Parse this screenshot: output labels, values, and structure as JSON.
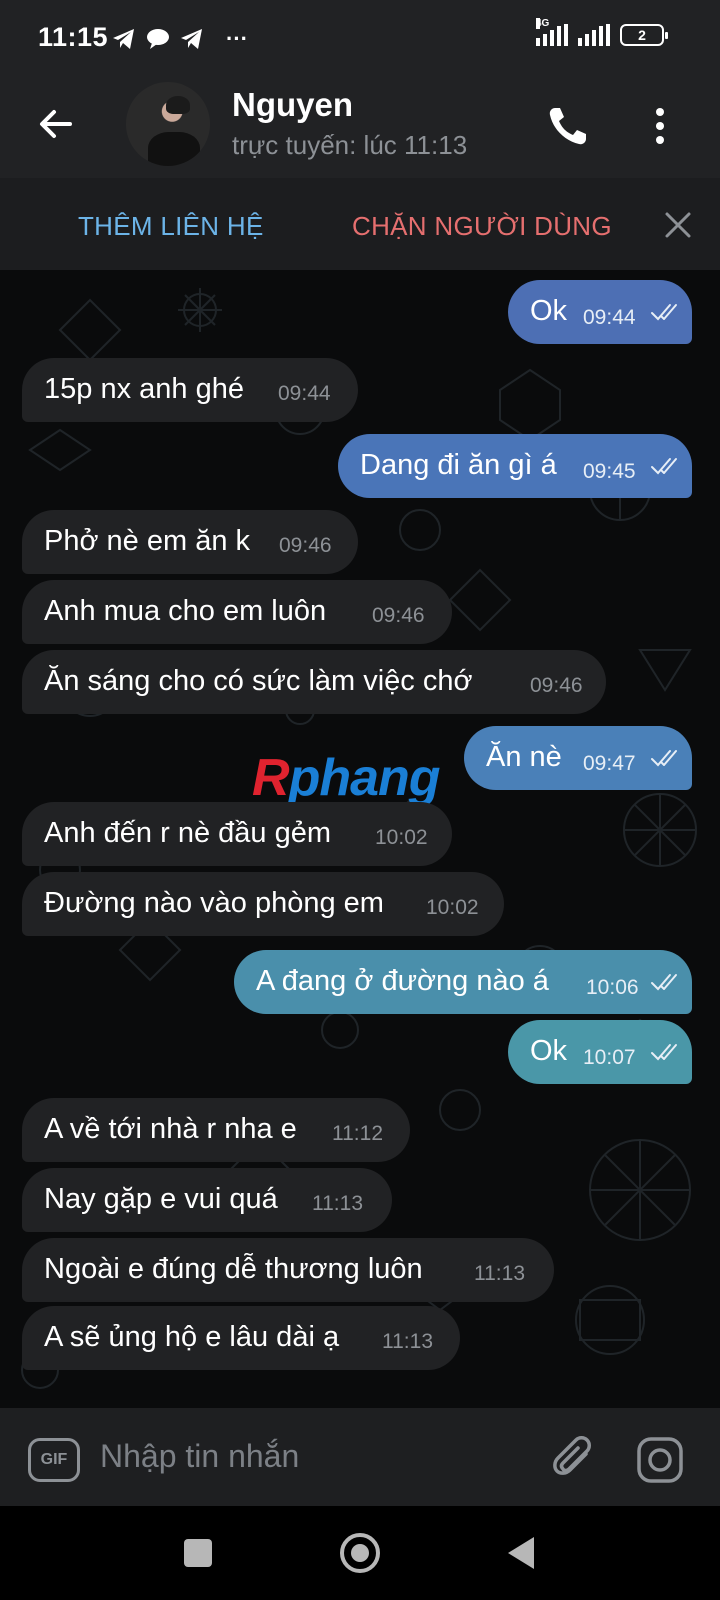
{
  "status_bar": {
    "time": "11:15",
    "network": "4G",
    "battery": "2",
    "more": "···"
  },
  "header": {
    "contact_name": "Nguyen",
    "presence": "trực tuyến: lúc 11:13"
  },
  "action_bar": {
    "add_contact": "THÊM LIÊN HỆ",
    "block_user": "CHẶN NGƯỜI DÙNG"
  },
  "colors": {
    "incoming_bubble": "#212224",
    "outgoing_blue": "#4a70b5",
    "outgoing_teal": "#4a94a6",
    "add_contact": "#6cb4e8",
    "block_user": "#e56f6f"
  },
  "messages": [
    {
      "side": "out",
      "text": "Ok",
      "time": "09:44"
    },
    {
      "side": "in",
      "text": "15p nx anh ghé",
      "time": "09:44"
    },
    {
      "side": "out",
      "text": "Dang đi ăn gì á",
      "time": "09:45"
    },
    {
      "side": "in",
      "text": "Phở nè em ăn k",
      "time": "09:46"
    },
    {
      "side": "in",
      "text": "Anh mua cho em luôn",
      "time": "09:46"
    },
    {
      "side": "in",
      "text": "Ăn sáng cho có sức làm việc chớ",
      "time": "09:46"
    },
    {
      "side": "out",
      "text": "Ăn nè",
      "time": "09:47"
    },
    {
      "side": "in",
      "text": "Anh đến r nè đầu gẻm",
      "time": "10:02"
    },
    {
      "side": "in",
      "text": "Đường nào vào phòng em",
      "time": "10:02"
    },
    {
      "side": "out",
      "text": "A đang ở đường nào á",
      "time": "10:06"
    },
    {
      "side": "out",
      "text": "Ok",
      "time": "10:07"
    },
    {
      "side": "in",
      "text": "A về tới nhà r nha e",
      "time": "11:12"
    },
    {
      "side": "in",
      "text": "Nay gặp e vui quá",
      "time": "11:13"
    },
    {
      "side": "in",
      "text": "Ngoài e đúng dễ thương luôn",
      "time": "11:13"
    },
    {
      "side": "in",
      "text": "A sẽ ủng hộ e lâu dài ạ",
      "time": "11:13"
    }
  ],
  "watermark": {
    "first": "R",
    "rest": "phang"
  },
  "input_bar": {
    "gif_label": "GIF",
    "placeholder": "Nhập tin nhắn"
  }
}
